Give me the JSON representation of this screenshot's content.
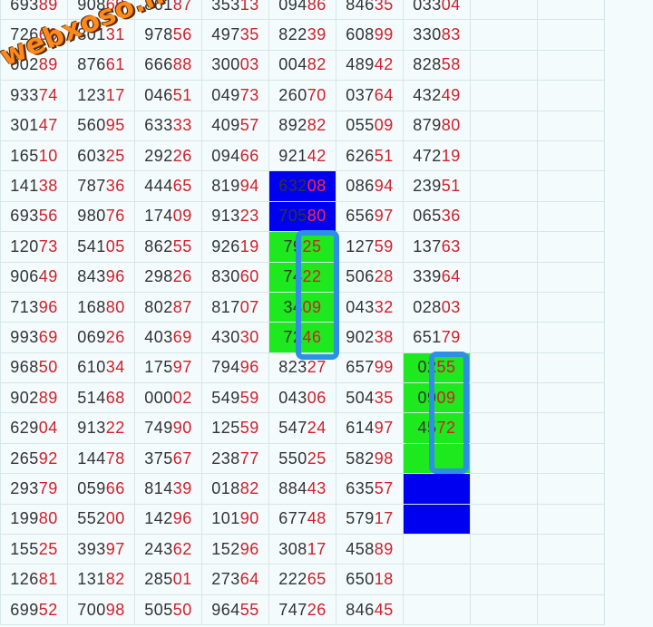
{
  "watermark": "webxoso.net",
  "colors": {
    "number_head": "#333333",
    "number_tail": "#d0202a",
    "cell_blue": "#0000f0",
    "cell_green": "#1ee81e",
    "highlight_box": "#2d8fe6",
    "grid_line": "#d6e6ea"
  },
  "rows": [
    [
      {
        "h": "693",
        "t": "89"
      },
      {
        "h": "908",
        "t": "69"
      },
      {
        "h": "861",
        "t": "87"
      },
      {
        "h": "353",
        "t": "13"
      },
      {
        "h": "094",
        "t": "86"
      },
      {
        "h": "846",
        "t": "35"
      },
      {
        "h": "033",
        "t": "04"
      }
    ],
    [
      {
        "h": "726",
        "t": "66"
      },
      {
        "h": "801",
        "t": "31"
      },
      {
        "h": "978",
        "t": "56"
      },
      {
        "h": "497",
        "t": "35"
      },
      {
        "h": "822",
        "t": "39"
      },
      {
        "h": "608",
        "t": "99"
      },
      {
        "h": "330",
        "t": "83"
      }
    ],
    [
      {
        "h": "002",
        "t": "89"
      },
      {
        "h": "876",
        "t": "61"
      },
      {
        "h": "666",
        "t": "88"
      },
      {
        "h": "300",
        "t": "03"
      },
      {
        "h": "004",
        "t": "82"
      },
      {
        "h": "489",
        "t": "42"
      },
      {
        "h": "828",
        "t": "58"
      }
    ],
    [
      {
        "h": "933",
        "t": "74"
      },
      {
        "h": "123",
        "t": "17"
      },
      {
        "h": "046",
        "t": "51"
      },
      {
        "h": "049",
        "t": "73"
      },
      {
        "h": "260",
        "t": "70"
      },
      {
        "h": "037",
        "t": "64"
      },
      {
        "h": "432",
        "t": "49"
      }
    ],
    [
      {
        "h": "301",
        "t": "47"
      },
      {
        "h": "560",
        "t": "95"
      },
      {
        "h": "633",
        "t": "33"
      },
      {
        "h": "409",
        "t": "57"
      },
      {
        "h": "892",
        "t": "82"
      },
      {
        "h": "055",
        "t": "09"
      },
      {
        "h": "879",
        "t": "80"
      }
    ],
    [
      {
        "h": "165",
        "t": "10"
      },
      {
        "h": "603",
        "t": "25"
      },
      {
        "h": "292",
        "t": "26"
      },
      {
        "h": "094",
        "t": "66"
      },
      {
        "h": "921",
        "t": "42"
      },
      {
        "h": "626",
        "t": "51"
      },
      {
        "h": "472",
        "t": "19"
      }
    ],
    [
      {
        "h": "141",
        "t": "38"
      },
      {
        "h": "787",
        "t": "36"
      },
      {
        "h": "444",
        "t": "65"
      },
      {
        "h": "819",
        "t": "94"
      },
      {
        "h": "632",
        "t": "08",
        "bg": "blue"
      },
      {
        "h": "086",
        "t": "94"
      },
      {
        "h": "239",
        "t": "51"
      }
    ],
    [
      {
        "h": "693",
        "t": "56"
      },
      {
        "h": "980",
        "t": "76"
      },
      {
        "h": "174",
        "t": "09"
      },
      {
        "h": "913",
        "t": "23"
      },
      {
        "h": "705",
        "t": "80",
        "bg": "blue"
      },
      {
        "h": "656",
        "t": "97"
      },
      {
        "h": "065",
        "t": "36"
      }
    ],
    [
      {
        "h": "120",
        "t": "73"
      },
      {
        "h": "541",
        "t": "05"
      },
      {
        "h": "862",
        "t": "55"
      },
      {
        "h": "926",
        "t": "19"
      },
      {
        "h": "79",
        "t": "25",
        "bg": "green"
      },
      {
        "h": "127",
        "t": "59"
      },
      {
        "h": "137",
        "t": "63"
      }
    ],
    [
      {
        "h": "906",
        "t": "49"
      },
      {
        "h": "843",
        "t": "96"
      },
      {
        "h": "298",
        "t": "26"
      },
      {
        "h": "830",
        "t": "60"
      },
      {
        "h": "74",
        "t": "22",
        "bg": "green"
      },
      {
        "h": "506",
        "t": "28"
      },
      {
        "h": "339",
        "t": "64"
      }
    ],
    [
      {
        "h": "713",
        "t": "96"
      },
      {
        "h": "168",
        "t": "80"
      },
      {
        "h": "802",
        "t": "87"
      },
      {
        "h": "817",
        "t": "07"
      },
      {
        "h": "34",
        "t": "09",
        "bg": "green"
      },
      {
        "h": "043",
        "t": "32"
      },
      {
        "h": "028",
        "t": "03"
      }
    ],
    [
      {
        "h": "993",
        "t": "69"
      },
      {
        "h": "069",
        "t": "26"
      },
      {
        "h": "403",
        "t": "69"
      },
      {
        "h": "430",
        "t": "30"
      },
      {
        "h": "72",
        "t": "46",
        "bg": "green"
      },
      {
        "h": "902",
        "t": "38"
      },
      {
        "h": "651",
        "t": "79"
      }
    ],
    [
      {
        "h": "968",
        "t": "50"
      },
      {
        "h": "610",
        "t": "34"
      },
      {
        "h": "175",
        "t": "97"
      },
      {
        "h": "794",
        "t": "96"
      },
      {
        "h": "823",
        "t": "27"
      },
      {
        "h": "657",
        "t": "99"
      },
      {
        "h": "02",
        "t": "55",
        "bg": "green"
      }
    ],
    [
      {
        "h": "902",
        "t": "89"
      },
      {
        "h": "514",
        "t": "68"
      },
      {
        "h": "000",
        "t": "02"
      },
      {
        "h": "549",
        "t": "59"
      },
      {
        "h": "043",
        "t": "06"
      },
      {
        "h": "504",
        "t": "35"
      },
      {
        "h": "09",
        "t": "09",
        "bg": "green"
      }
    ],
    [
      {
        "h": "629",
        "t": "04"
      },
      {
        "h": "913",
        "t": "22"
      },
      {
        "h": "749",
        "t": "90"
      },
      {
        "h": "125",
        "t": "59"
      },
      {
        "h": "547",
        "t": "24"
      },
      {
        "h": "614",
        "t": "97"
      },
      {
        "h": "45",
        "t": "72",
        "bg": "green"
      }
    ],
    [
      {
        "h": "265",
        "t": "92"
      },
      {
        "h": "144",
        "t": "78"
      },
      {
        "h": "375",
        "t": "67"
      },
      {
        "h": "238",
        "t": "77"
      },
      {
        "h": "550",
        "t": "25"
      },
      {
        "h": "582",
        "t": "98"
      },
      {
        "h": "",
        "t": "",
        "bg": "green"
      }
    ],
    [
      {
        "h": "293",
        "t": "79"
      },
      {
        "h": "059",
        "t": "66"
      },
      {
        "h": "814",
        "t": "39"
      },
      {
        "h": "018",
        "t": "82"
      },
      {
        "h": "884",
        "t": "43"
      },
      {
        "h": "635",
        "t": "57"
      },
      {
        "h": "",
        "t": "",
        "bg": "blue"
      }
    ],
    [
      {
        "h": "199",
        "t": "80"
      },
      {
        "h": "552",
        "t": "00"
      },
      {
        "h": "142",
        "t": "96"
      },
      {
        "h": "101",
        "t": "90"
      },
      {
        "h": "677",
        "t": "48"
      },
      {
        "h": "579",
        "t": "17"
      },
      {
        "h": "",
        "t": "",
        "bg": "blue"
      }
    ],
    [
      {
        "h": "155",
        "t": "25"
      },
      {
        "h": "393",
        "t": "97"
      },
      {
        "h": "243",
        "t": "62"
      },
      {
        "h": "152",
        "t": "96"
      },
      {
        "h": "308",
        "t": "17"
      },
      {
        "h": "458",
        "t": "89"
      },
      {
        "h": "",
        "t": ""
      }
    ],
    [
      {
        "h": "126",
        "t": "81"
      },
      {
        "h": "131",
        "t": "82"
      },
      {
        "h": "285",
        "t": "01"
      },
      {
        "h": "273",
        "t": "64"
      },
      {
        "h": "222",
        "t": "65"
      },
      {
        "h": "650",
        "t": "18"
      },
      {
        "h": "",
        "t": ""
      }
    ],
    [
      {
        "h": "699",
        "t": "52"
      },
      {
        "h": "700",
        "t": "98"
      },
      {
        "h": "505",
        "t": "50"
      },
      {
        "h": "964",
        "t": "55"
      },
      {
        "h": "747",
        "t": "26"
      },
      {
        "h": "846",
        "t": "45"
      },
      {
        "h": "",
        "t": ""
      }
    ]
  ]
}
